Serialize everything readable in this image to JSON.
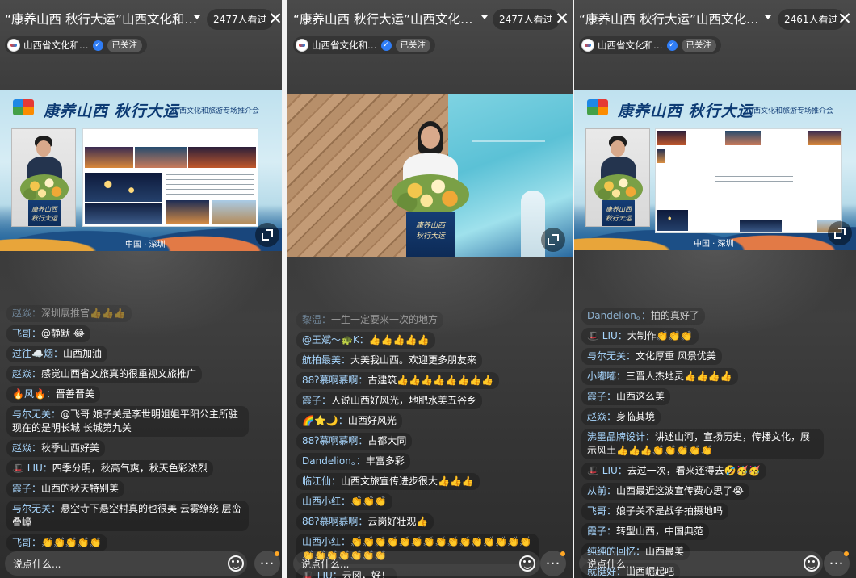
{
  "panels": [
    {
      "title": "“康养山西 秋行大运”山西文化和…",
      "viewers": "2477人看过",
      "account": "山西省文化和…",
      "follow_badge": "已关注",
      "slide": {
        "headline": "康养山西 秋行大运",
        "subtitle": "山西文化和旅游专场推介会",
        "footer": "中国 · 深圳",
        "podium": "康养山西\n秋行大运"
      },
      "comments": [
        {
          "nick": "赵焱：",
          "text": "深圳展推官👍👍👍",
          "dim": true
        },
        {
          "nick": "飞哥：",
          "text": "@静默 😂"
        },
        {
          "nick": "过往☁️烟：",
          "text": "山西加油"
        },
        {
          "nick": "赵焱：",
          "text": "感觉山西省文旅真的很重视文旅推广"
        },
        {
          "nick": "🔥风🔥：",
          "text": "晋善晋美"
        },
        {
          "nick": "与尔无关：",
          "text": "@飞哥 娘子关是李世明姐姐平阳公主所驻 现在的是明长城 长城第九关"
        },
        {
          "nick": "赵焱：",
          "text": "秋季山西好美"
        },
        {
          "nick": "🎩 LIU：",
          "text": "四季分明，秋高气爽，秋天色彩浓烈"
        },
        {
          "nick": "霞子：",
          "text": "山西的秋天特别美"
        },
        {
          "nick": "与尔无关：",
          "text": "悬空寺下悬空村真的也很美 云雾缭绕 层峦叠嶂"
        },
        {
          "nick": "飞哥：",
          "text": "👏👏👏👏👏"
        }
      ],
      "input_placeholder": "说点什么..."
    },
    {
      "title": "“康养山西 秋行大运”山西文化和…",
      "viewers": "2477人看过",
      "account": "山西省文化和…",
      "follow_badge": "已关注",
      "slide": {
        "podium": "康养山西\n秋行大运"
      },
      "comments": [
        {
          "nick": "黎温：",
          "text": "一生一定要来一次的地方",
          "dim": true
        },
        {
          "nick": "@王斌～🐢K：",
          "text": "👍👍👍👍👍"
        },
        {
          "nick": "航拍最美：",
          "text": "大美我山西。欢迎更多朋友来"
        },
        {
          "nick": "88ʔ慕啊慕啊：",
          "text": "古建筑👍👍👍👍👍👍👍👍"
        },
        {
          "nick": "霞子：",
          "text": "人说山西好风光，地肥水美五谷乡"
        },
        {
          "nick": "🌈⭐🌙：",
          "text": "山西好风光"
        },
        {
          "nick": "88ʔ慕啊慕啊：",
          "text": "古都大同"
        },
        {
          "nick": "Dandelion。：",
          "text": "丰富多彩"
        },
        {
          "nick": "临江仙：",
          "text": "山西文旅宣传进步很大👍👍👍"
        },
        {
          "nick": "山西小红：",
          "text": "👏👏👏"
        },
        {
          "nick": "88ʔ慕啊慕啊：",
          "text": "云岗好壮观👍"
        },
        {
          "nick": "山西小红：",
          "text": "👏👏👏👏👏👏👏👏👏👏👏👏👏👏👏👏👏👏👏👏👏👏"
        },
        {
          "nick": "🎩 LIU：",
          "text": "云冈，好！"
        }
      ],
      "input_placeholder": "说点什么..."
    },
    {
      "title": "“康养山西 秋行大运”山西文化和…",
      "viewers": "2461人看过",
      "account": "山西省文化和…",
      "follow_badge": "已关注",
      "slide": {
        "headline": "康养山西 秋行大运",
        "subtitle": "山西文化和旅游专场推介会",
        "footer": "中国 · 深圳",
        "podium": "康养山西\n秋行大运"
      },
      "comments": [
        {
          "nick": "Dandelion。：",
          "text": "拍的真好了",
          "fade": true
        },
        {
          "nick": "🎩 LIU：",
          "text": "大制作👏👏👏"
        },
        {
          "nick": "与尔无关：",
          "text": "文化厚重 风景优美"
        },
        {
          "nick": "小嘟嘟：",
          "text": "三晋人杰地灵👍👍👍👍"
        },
        {
          "nick": "霞子：",
          "text": "山西这么美"
        },
        {
          "nick": "赵焱：",
          "text": "身临其境"
        },
        {
          "nick": "沸墨品牌设计：",
          "text": "讲述山河，宣扬历史，传播文化，展示风土👍👍👍👏👏👏👏👏"
        },
        {
          "nick": "🎩 LIU：",
          "text": "去过一次，看来还得去🤣🥳🥳"
        },
        {
          "nick": "从前：",
          "text": "山西最近这波宣传费心思了😭"
        },
        {
          "nick": "飞哥：",
          "text": "娘子关不是战争拍摄地吗"
        },
        {
          "nick": "霞子：",
          "text": "转型山西，中国典范"
        },
        {
          "nick": "纯纯的回忆：",
          "text": "山西最美"
        },
        {
          "nick": "就挺好：",
          "text": "山西崛起吧"
        }
      ],
      "input_placeholder": "说点什么..."
    }
  ]
}
